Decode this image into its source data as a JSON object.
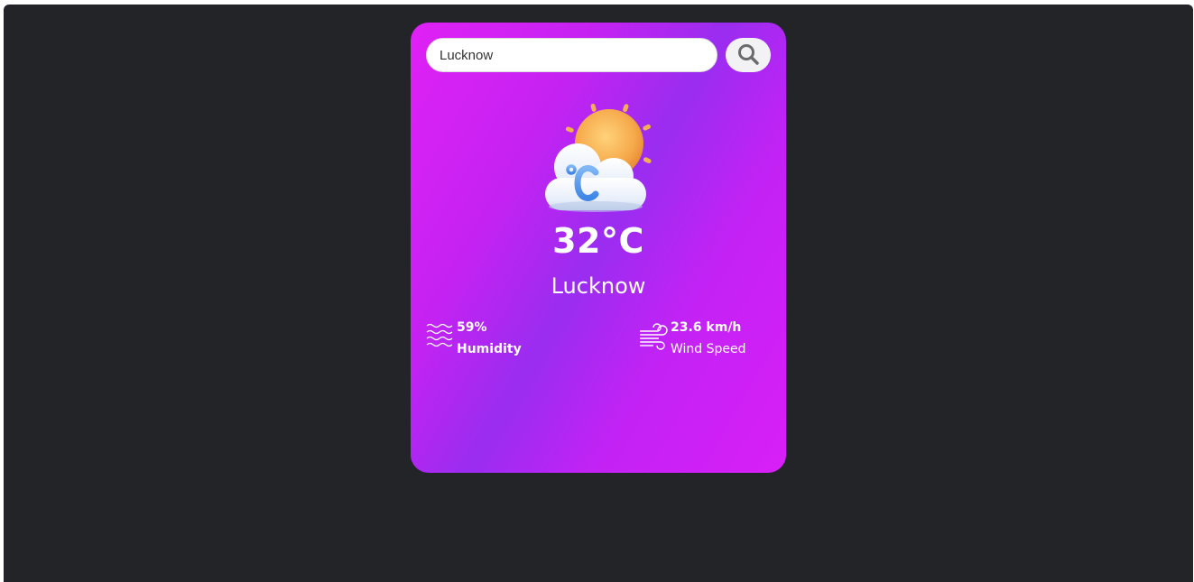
{
  "search": {
    "value": "Lucknow",
    "button_icon": "search-icon"
  },
  "weather": {
    "icon": "sun-behind-cloud-celsius-icon",
    "temperature": "32°C",
    "city": "Lucknow"
  },
  "humidity": {
    "icon": "humidity-waves-icon",
    "value": "59%",
    "label": "Humidity"
  },
  "wind": {
    "icon": "wind-icon",
    "value": "23.6 km/h",
    "label": "Wind Speed"
  },
  "colors": {
    "background": "#222428",
    "card_gradient_start": "#e021f5",
    "card_gradient_mid": "#9a2df0",
    "card_gradient_end": "#d81ff7",
    "text": "#ffffff"
  }
}
